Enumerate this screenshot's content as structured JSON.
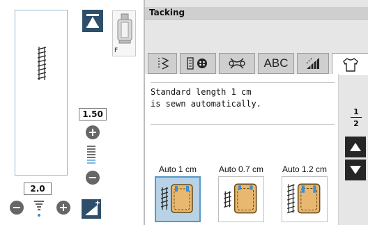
{
  "left_panel": {
    "foot_label": "F",
    "stitch_length": "1.50",
    "stitch_width": "2.0"
  },
  "header": {
    "title": "Tacking"
  },
  "tabs": [
    {
      "id": "utility",
      "label": "",
      "icon": "utility-stitch-icon"
    },
    {
      "id": "buttonhole",
      "label": "",
      "icon": "buttonhole-icon"
    },
    {
      "id": "decorative",
      "label": "",
      "icon": "decorative-stitch-icon"
    },
    {
      "id": "alphabet",
      "label": "ABC",
      "icon": ""
    },
    {
      "id": "quilt",
      "label": "",
      "icon": "quilt-stitch-icon"
    },
    {
      "id": "garment",
      "label": "",
      "icon": "shirt-icon",
      "active": true
    }
  ],
  "message": "Standard length 1 cm\nis sewn automatically.",
  "pagination": {
    "current": "1",
    "total": "2"
  },
  "options": [
    {
      "label": "Auto 1 cm",
      "selected": true
    },
    {
      "label": "Auto 0.7 cm",
      "selected": false
    },
    {
      "label": "Auto 1.2 cm",
      "selected": false
    }
  ],
  "colors": {
    "accent_dark": "#2e4f6b",
    "selection": "#b8d2e6",
    "pocket_fill": "#e8b870",
    "bar_tack_blue": "#3b8fd0"
  }
}
